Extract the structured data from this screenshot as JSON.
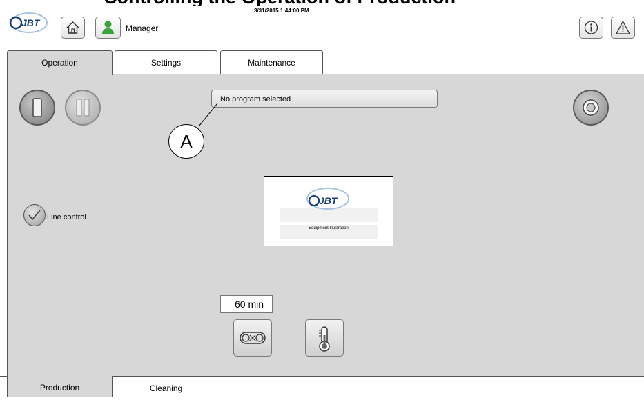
{
  "header": {
    "clipped_title": "Controlling the Operation of Production",
    "datetime": "3/31/2015 1:44:00 PM",
    "logo_text": "JBT",
    "user_role": "Manager",
    "home_icon": "home-icon",
    "user_icon": "user-icon",
    "info_icon": "info-icon",
    "warning_icon": "warning-icon"
  },
  "tabs": [
    {
      "label": "Operation",
      "active": true
    },
    {
      "label": "Settings",
      "active": false
    },
    {
      "label": "Maintenance",
      "active": false
    }
  ],
  "main": {
    "program_status": "No program selected",
    "callout_label": "A",
    "line_control_label": "Line control",
    "illustration_label": "Equipment Illustration",
    "illustration_logo": "JBT",
    "duration": "60 min"
  },
  "bottom_tabs": [
    {
      "label": "Production",
      "active": true
    },
    {
      "label": "Cleaning",
      "active": false
    }
  ],
  "colors": {
    "panel_bg": "#d7d7d7",
    "user_icon_green": "#3aa33a",
    "logo_blue": "#1a3f7a"
  }
}
